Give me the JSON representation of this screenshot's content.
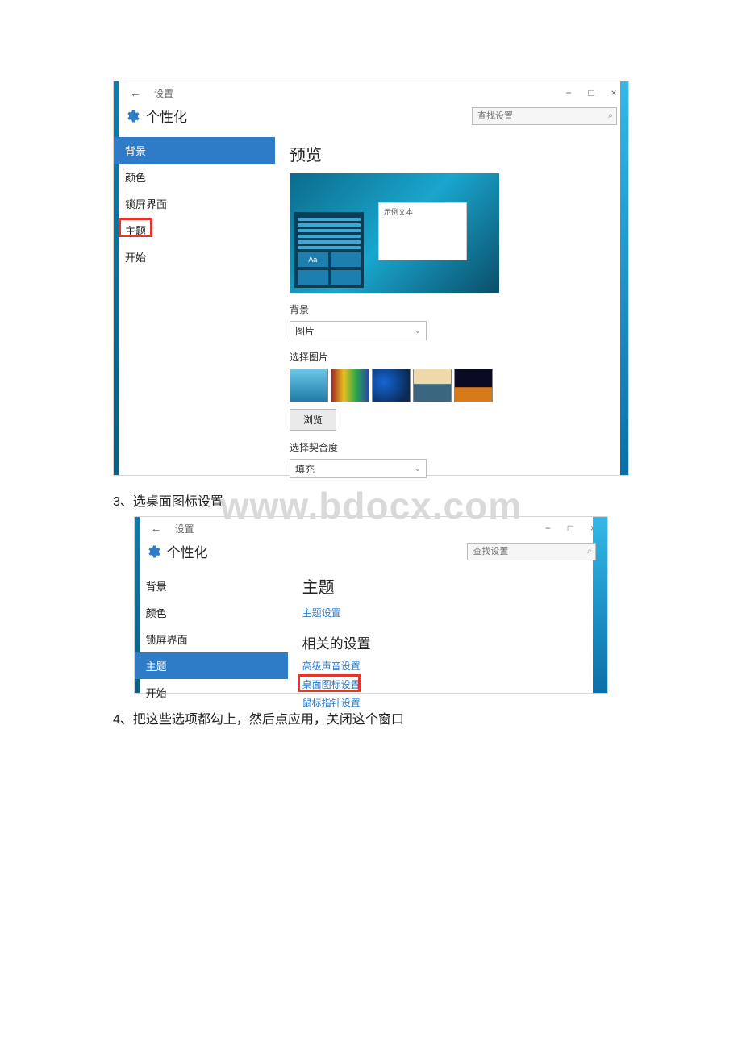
{
  "watermark": "www.bdocx.com",
  "steps": {
    "s3": "3、选桌面图标设置",
    "s4": "4、把这些选项都勾上，然后点应用，关闭这个窗口"
  },
  "win1": {
    "titlebar": {
      "back": "←",
      "title": "设置",
      "min": "−",
      "max": "□",
      "close": "×"
    },
    "header": {
      "title": "个性化"
    },
    "search": {
      "placeholder": "查找设置"
    },
    "sidebar": {
      "items": [
        {
          "label": "背景"
        },
        {
          "label": "颜色"
        },
        {
          "label": "锁屏界面"
        },
        {
          "label": "主题"
        },
        {
          "label": "开始"
        }
      ]
    },
    "content": {
      "preview_heading": "预览",
      "sample_text": "示例文本",
      "tile_aa": "Aa",
      "bg_label": "背景",
      "bg_dropdown": "图片",
      "choose_pic_label": "选择图片",
      "browse": "浏览",
      "fit_label": "选择契合度",
      "fit_dropdown": "填充"
    }
  },
  "win2": {
    "titlebar": {
      "back": "←",
      "title": "设置",
      "min": "−",
      "max": "□",
      "close": "×"
    },
    "header": {
      "title": "个性化"
    },
    "search": {
      "placeholder": "查找设置"
    },
    "sidebar": {
      "items": [
        {
          "label": "背景"
        },
        {
          "label": "颜色"
        },
        {
          "label": "锁屏界面"
        },
        {
          "label": "主题"
        },
        {
          "label": "开始"
        }
      ]
    },
    "content": {
      "theme_heading": "主题",
      "theme_settings_link": "主题设置",
      "related_heading": "相关的设置",
      "adv_sound_link": "高级声音设置",
      "desktop_icon_link": "桌面图标设置",
      "mouse_link": "鼠标指针设置"
    }
  }
}
